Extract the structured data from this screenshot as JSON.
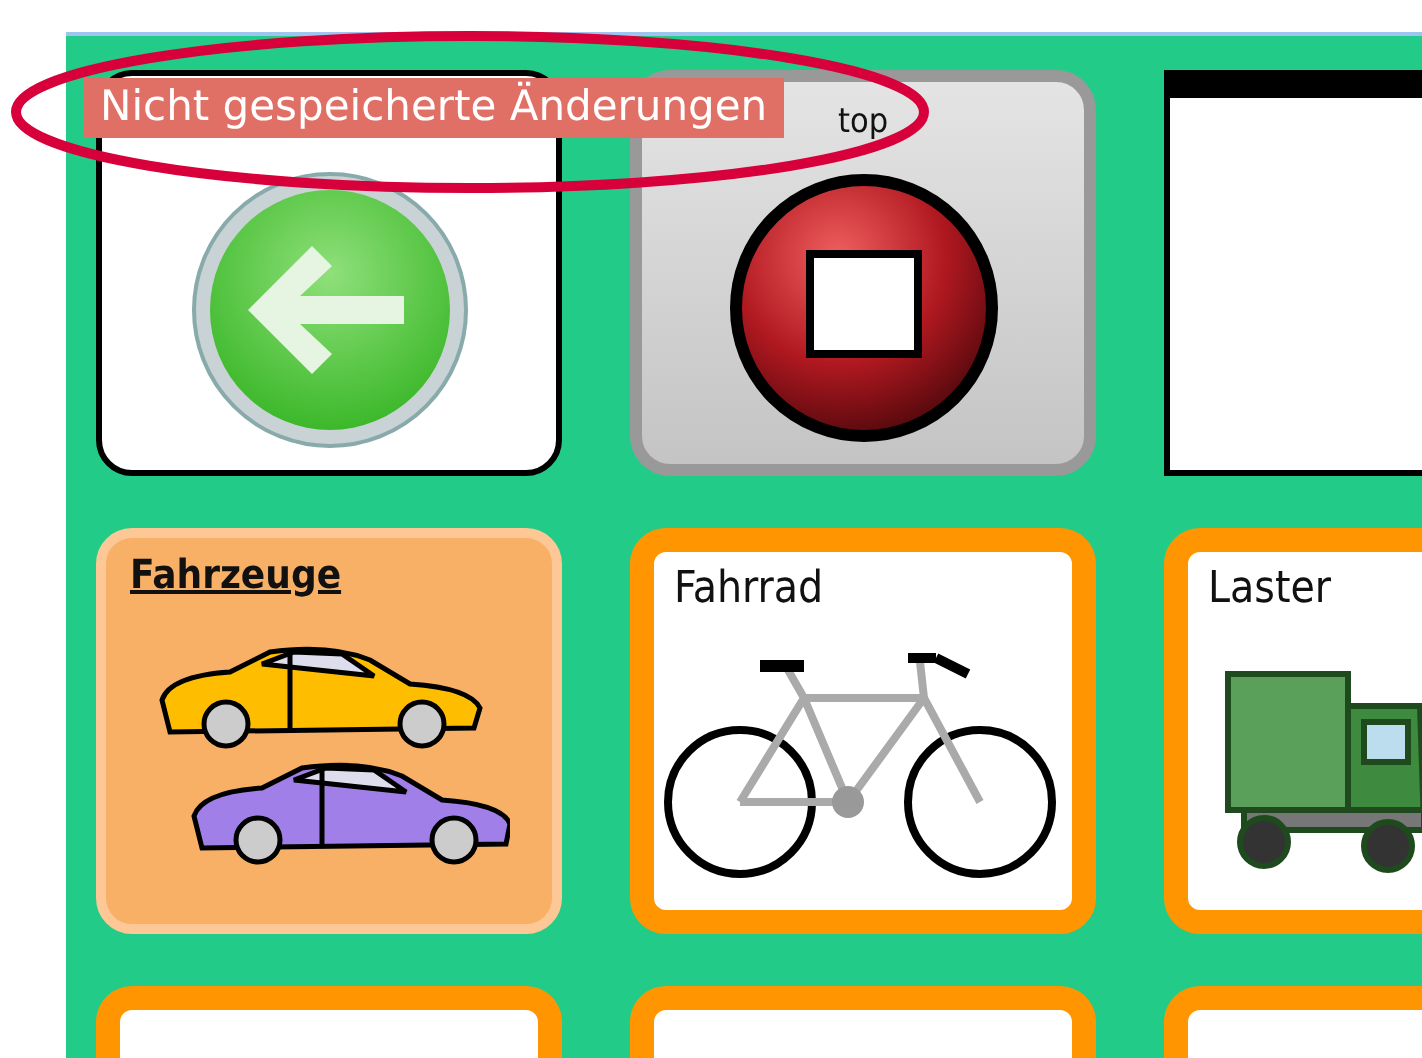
{
  "notice": {
    "text": "Nicht gespeicherte Änderungen"
  },
  "tiles": [
    {
      "kind": "action"
    },
    {
      "kind": "action-grey",
      "label": "top"
    },
    {
      "kind": "blank"
    },
    {
      "kind": "folder",
      "label": "Fahrzeuge"
    },
    {
      "kind": "word",
      "label": "Fahrrad"
    },
    {
      "kind": "word",
      "label": "Laster"
    },
    {
      "kind": "word"
    },
    {
      "kind": "word"
    },
    {
      "kind": "word"
    }
  ]
}
